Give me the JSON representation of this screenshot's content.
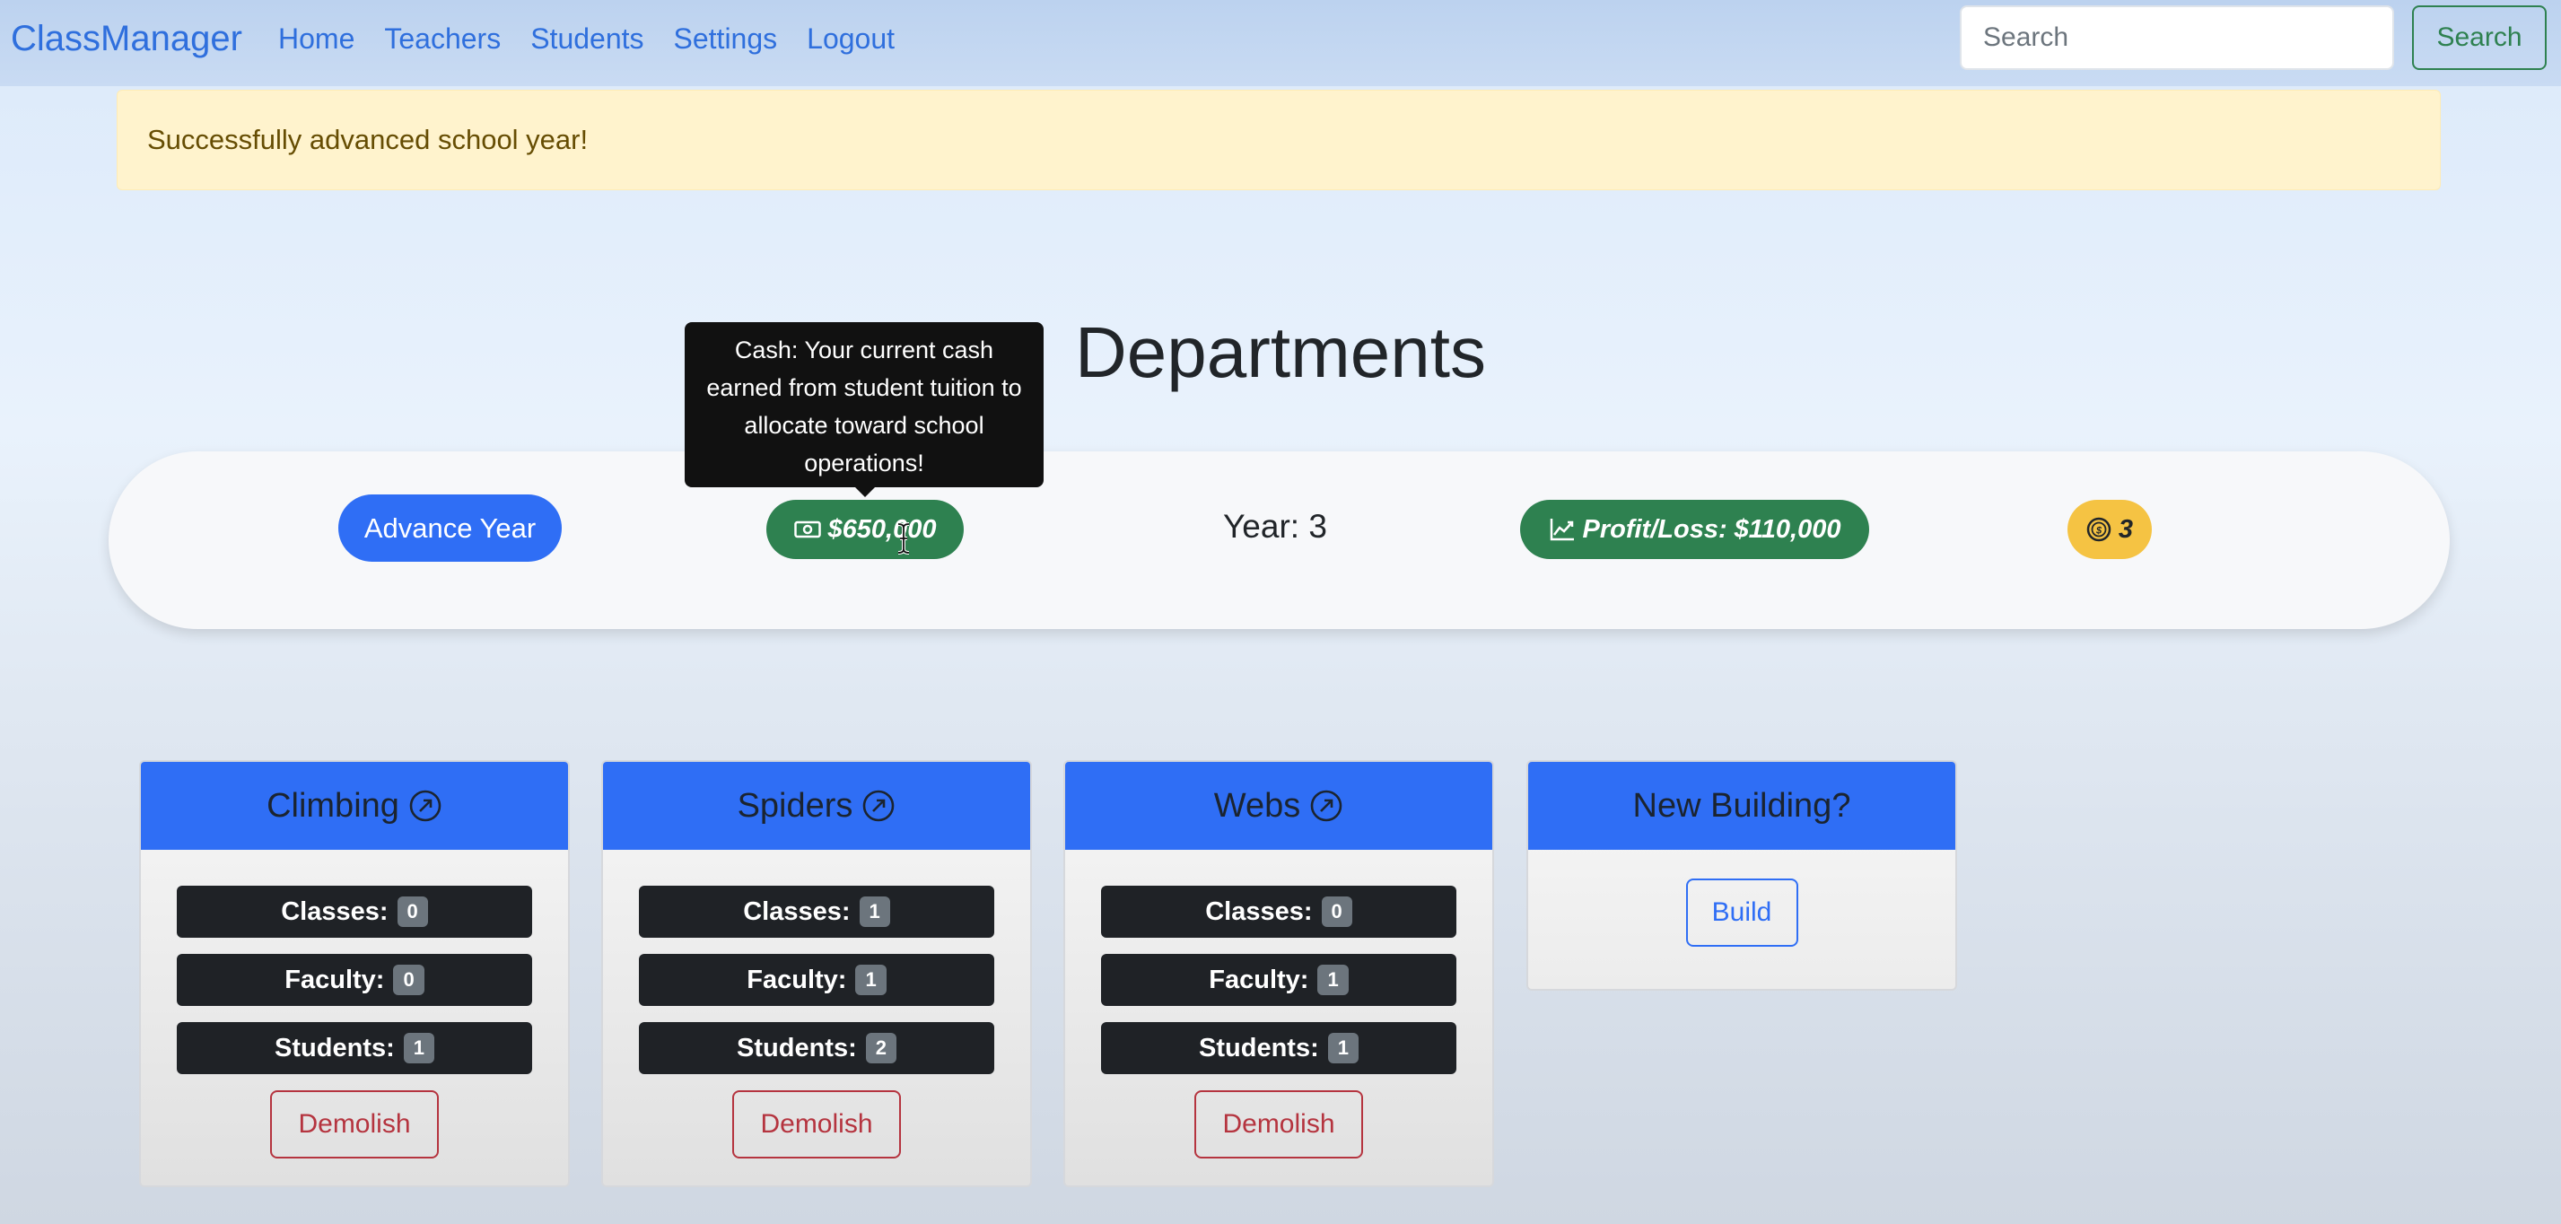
{
  "navbar": {
    "brand": "ClassManager",
    "links": [
      {
        "label": "Home"
      },
      {
        "label": "Teachers"
      },
      {
        "label": "Students"
      },
      {
        "label": "Settings"
      },
      {
        "label": "Logout"
      }
    ],
    "search_placeholder": "Search",
    "search_value": "",
    "search_button": "Search"
  },
  "alert": {
    "message": "Successfully advanced school year!"
  },
  "page": {
    "title": "Departments"
  },
  "stats": {
    "advance_button": "Advance Year",
    "cash": "$650,000",
    "cash_icon": "cash-icon",
    "year_label": "Year: 3",
    "profit_loss": "Profit/Loss: $110,000",
    "profit_icon": "graph-up-icon",
    "coins": "3",
    "coin_icon": "coin-icon",
    "tooltip": "Cash: Your current cash earned from student tuition to allocate toward school operations!"
  },
  "departments": [
    {
      "name": "Climbing",
      "icon": "external-link-icon",
      "stats": [
        {
          "label": "Classes:",
          "value": "0"
        },
        {
          "label": "Faculty:",
          "value": "0"
        },
        {
          "label": "Students:",
          "value": "1"
        }
      ],
      "action": "Demolish"
    },
    {
      "name": "Spiders",
      "icon": "external-link-icon",
      "stats": [
        {
          "label": "Classes:",
          "value": "1"
        },
        {
          "label": "Faculty:",
          "value": "1"
        },
        {
          "label": "Students:",
          "value": "2"
        }
      ],
      "action": "Demolish"
    },
    {
      "name": "Webs",
      "icon": "external-link-icon",
      "stats": [
        {
          "label": "Classes:",
          "value": "0"
        },
        {
          "label": "Faculty:",
          "value": "1"
        },
        {
          "label": "Students:",
          "value": "1"
        }
      ],
      "action": "Demolish"
    }
  ],
  "new_building": {
    "title": "New Building?",
    "action": "Build"
  },
  "colors": {
    "primary": "#2f6ef5",
    "success": "#2e8150",
    "warning": "#f5c343",
    "danger": "#b5343f",
    "alert_bg": "#fff3cd",
    "tooltip_bg": "#111111"
  }
}
